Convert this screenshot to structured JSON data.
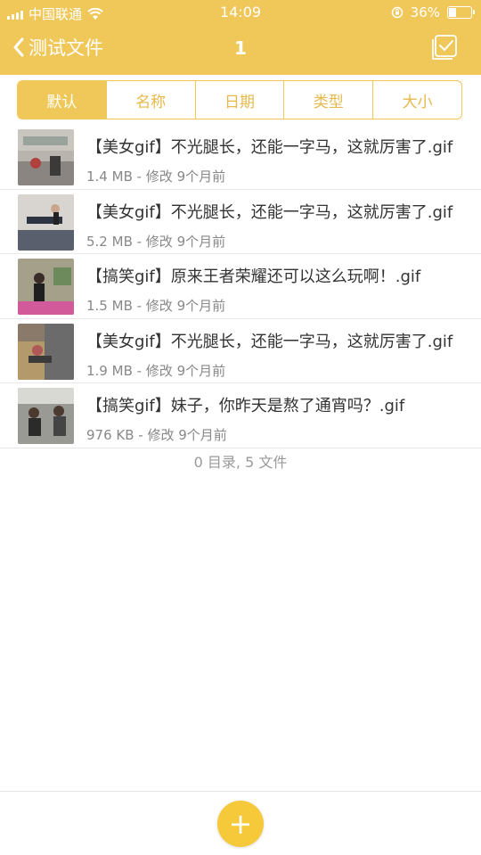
{
  "status_bar": {
    "carrier": "中国联通",
    "time": "14:09",
    "battery": "36%",
    "battery_level": 0.36
  },
  "nav": {
    "back_label": "测试文件",
    "count": "1"
  },
  "sort_tabs": [
    {
      "label": "默认",
      "active": true
    },
    {
      "label": "名称",
      "active": false
    },
    {
      "label": "日期",
      "active": false
    },
    {
      "label": "类型",
      "active": false
    },
    {
      "label": "大小",
      "active": false
    }
  ],
  "files": [
    {
      "name": "【美女gif】不光腿长，还能一字马，这就厉害了.gif",
      "meta": "1.4 MB - 修改 9个月前"
    },
    {
      "name": "【美女gif】不光腿长，还能一字马，这就厉害了.gif",
      "meta": "5.2 MB - 修改 9个月前"
    },
    {
      "name": "【搞笑gif】原来王者荣耀还可以这么玩啊！.gif",
      "meta": "1.5 MB - 修改 9个月前"
    },
    {
      "name": "【美女gif】不光腿长，还能一字马，这就厉害了.gif",
      "meta": "1.9 MB - 修改 9个月前"
    },
    {
      "name": "【搞笑gif】妹子，你昨天是熬了通宵吗？.gif",
      "meta": "976 KB - 修改 9个月前"
    }
  ],
  "summary": "0 目录, 5 文件",
  "fab_label": "+",
  "colors": {
    "accent": "#f0c85a",
    "fab": "#f5c93a"
  }
}
